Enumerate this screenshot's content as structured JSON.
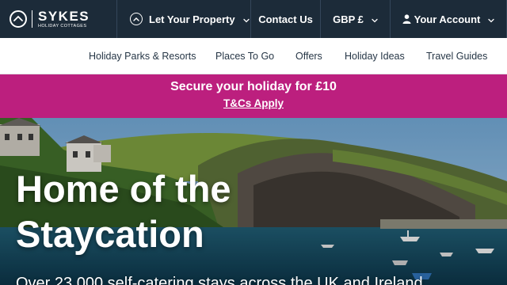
{
  "topbar": {
    "logo": {
      "brand": "SYKES",
      "sub": "HOLIDAY COTTAGES",
      "icon": "sykes-logo-icon"
    },
    "let_property": "Let Your Property",
    "contact_us": "Contact Us",
    "currency": "GBP £",
    "account": "Your Account"
  },
  "subnav": {
    "items": [
      {
        "label": "Holiday Parks & Resorts"
      },
      {
        "label": "Places To Go"
      },
      {
        "label": "Offers"
      },
      {
        "label": "Holiday Ideas"
      },
      {
        "label": "Travel Guides"
      }
    ]
  },
  "promo": {
    "title": "Secure your holiday for £10",
    "link": "T&Cs Apply",
    "color": "#bc1f7e"
  },
  "hero": {
    "title_line1": "Home of the",
    "title_line2": "Staycation",
    "subtitle": "Over 23,000 self-catering stays across the UK and Ireland"
  },
  "colors": {
    "nav_bg": "#1c2b39",
    "accent": "#bc1f7e",
    "nav_text": "#263646"
  }
}
